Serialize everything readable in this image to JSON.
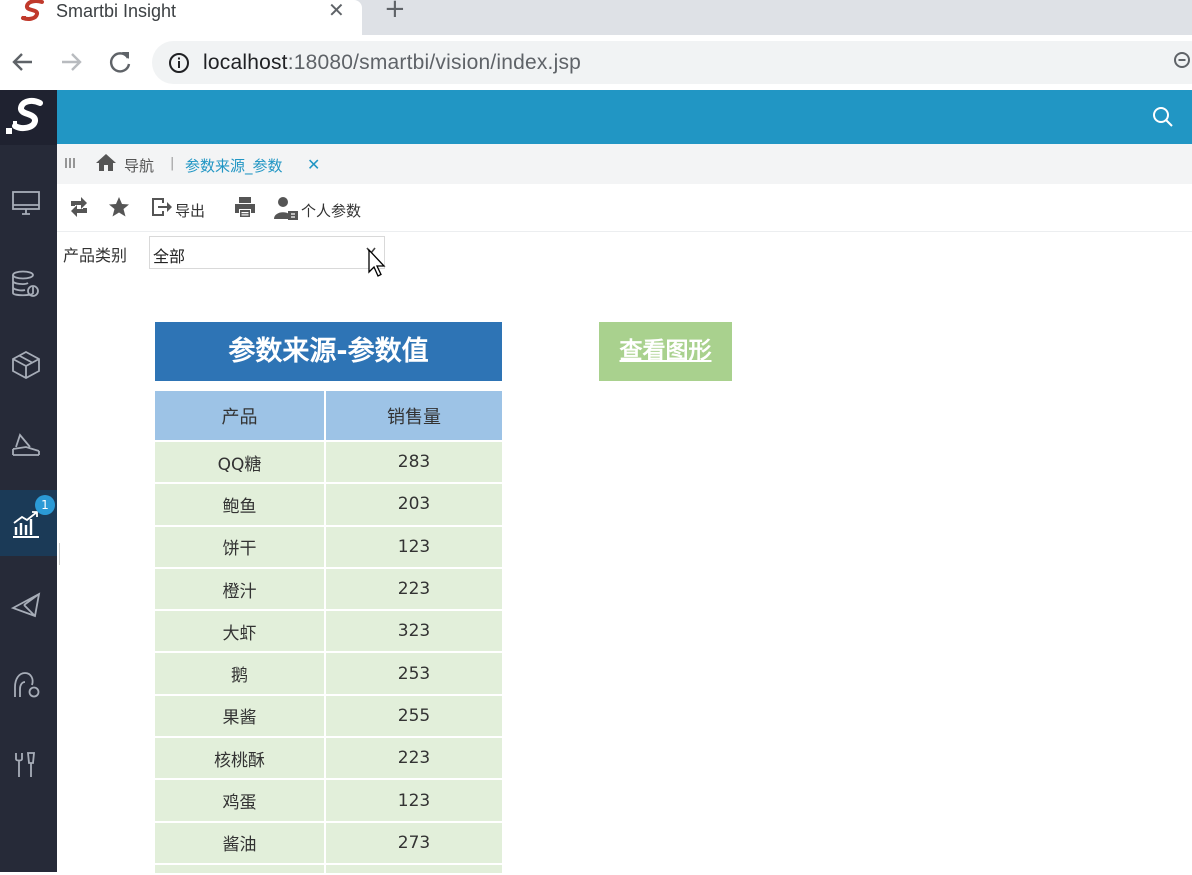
{
  "browser": {
    "tab_title": "Smartbi Insight",
    "tab_close": "✕",
    "new_tab": "+",
    "url_host": "localhost",
    "url_path": ":18080/smartbi/vision/index.jsp"
  },
  "app": {
    "brand_color": "#2196c4",
    "sidebar_color": "#262a38",
    "nav_label": "导航",
    "tab_separator": "|",
    "active_tab_label": "参数来源_参数",
    "active_tab_close": "✕",
    "sidebar_badge": "1",
    "sidebar_items": [
      "monitor-icon",
      "database-settings-icon",
      "cube-icon",
      "analysis-icon",
      "chart-icon",
      "send-icon",
      "user-settings-icon",
      "tools-icon"
    ]
  },
  "toolbar": {
    "export_label": "导出",
    "personal_params_label": "个人参数"
  },
  "params": {
    "category_label": "产品类别",
    "category_value": "全部"
  },
  "report": {
    "title": "参数来源-参数值",
    "chart_link": "查看图形",
    "columns": [
      "产品",
      "销售量"
    ],
    "rows": [
      [
        "QQ糖",
        "283"
      ],
      [
        "鲍鱼",
        "203"
      ],
      [
        "饼干",
        "123"
      ],
      [
        "橙汁",
        "223"
      ],
      [
        "大虾",
        "323"
      ],
      [
        "鹅",
        "253"
      ],
      [
        "果酱",
        "255"
      ],
      [
        "核桃酥",
        "223"
      ],
      [
        "鸡蛋",
        "123"
      ],
      [
        "酱油",
        "273"
      ]
    ]
  }
}
